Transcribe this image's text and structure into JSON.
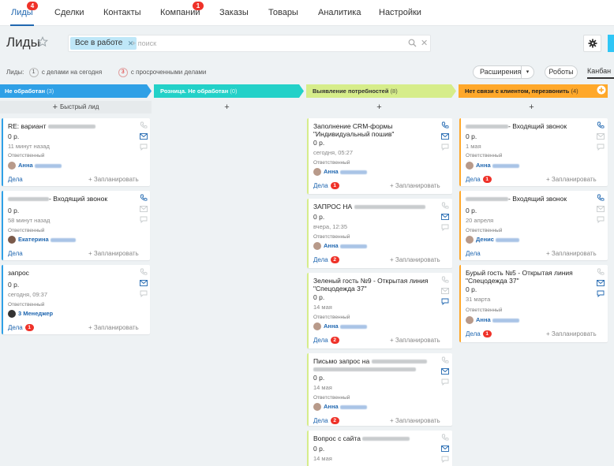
{
  "nav": {
    "items": [
      {
        "label": "Лиды",
        "badge": "4"
      },
      {
        "label": "Сделки"
      },
      {
        "label": "Контакты"
      },
      {
        "label": "Компании",
        "badge": "1"
      },
      {
        "label": "Заказы"
      },
      {
        "label": "Товары"
      },
      {
        "label": "Аналитика"
      },
      {
        "label": "Настройки"
      }
    ]
  },
  "header": {
    "title": "Лиды",
    "filter_chip": "Все в работе",
    "search_placeholder": "+ поиск"
  },
  "counters": {
    "label": "Лиды:",
    "today_count": "1",
    "today_text": "с делами на сегодня",
    "overdue_count": "3",
    "overdue_text": "с просроченными делами"
  },
  "toolbar": {
    "extensions": "Расширения",
    "robots": "Роботы",
    "kanban": "Канбан"
  },
  "colors": {
    "col1": "#2fa0e6",
    "col2": "#23d1c8",
    "col3": "#d6ed8a",
    "col4": "#ffa82a",
    "accent": "#2067b0",
    "badge": "#ef3229"
  },
  "columns": [
    {
      "title": "Не обработан",
      "count": "(3)",
      "add_label": "Быстрый лид"
    },
    {
      "title": "Розница. Не обработан",
      "count": "(0)",
      "add_label": ""
    },
    {
      "title": "Выявление потребностей",
      "count": "(8)",
      "add_label": ""
    },
    {
      "title": "Нет связи с клиентом, перезвонить",
      "count": "(4)",
      "add_label": ""
    }
  ],
  "labels": {
    "responsible": "Ответственный",
    "deals": "Дела",
    "planned": "+ Запланировать"
  },
  "cards": {
    "c1_1": {
      "title": "RE: вариант",
      "price": "0 р.",
      "date": "11 минут назад",
      "user": "Анна",
      "deals_badge": ""
    },
    "c1_2": {
      "title": "- Входящий звонок",
      "price": "0 р.",
      "date": "58 минут назад",
      "user": "Екатерина",
      "deals_badge": ""
    },
    "c1_3": {
      "title": "запрос",
      "price": "0 р.",
      "date": "сегодня, 09:37",
      "user": "3 Менеджер",
      "deals_badge": "1"
    },
    "c3_1": {
      "title": "Заполнение CRM-формы \"Индивидуальный пошив\"",
      "price": "0 р.",
      "date": "сегодня, 05:27",
      "user": "Анна",
      "deals_badge": "1"
    },
    "c3_2": {
      "title": "ЗАПРОС НА",
      "price": "0 р.",
      "date": "вчера, 12:35",
      "user": "Анна",
      "deals_badge": "2"
    },
    "c3_3": {
      "title": "Зеленый гость №9 - Открытая линия \"Спецодежда 37\"",
      "price": "0 р.",
      "date": "14 мая",
      "user": "Анна",
      "deals_badge": "2"
    },
    "c3_4": {
      "title": "Письмо запрос на",
      "price": "0 р.",
      "date": "14 мая",
      "user": "Анна",
      "deals_badge": "2"
    },
    "c3_5": {
      "title": "Вопрос с сайта",
      "price": "0 р.",
      "date": "14 мая"
    },
    "c4_1": {
      "title": "- Входящий звонок",
      "price": "0 р.",
      "date": "1 мая",
      "user": "Анна",
      "deals_badge": "1"
    },
    "c4_2": {
      "title": "- Входящий звонок",
      "price": "0 р.",
      "date": "20 апреля",
      "user": "Денис",
      "deals_badge": ""
    },
    "c4_3": {
      "title": "Бурый гость №5 - Открытая линия \"Спецодежда 37\"",
      "price": "0 р.",
      "date": "31 марта",
      "user": "Анна",
      "deals_badge": "1"
    }
  }
}
